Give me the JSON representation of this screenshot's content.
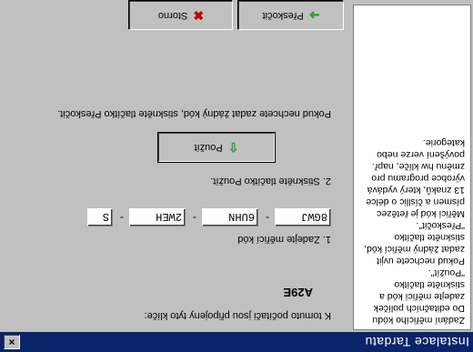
{
  "window": {
    "title": "Instalace Tardatu",
    "close_label": "×"
  },
  "sidebar": {
    "text": "Zadání měřicího kódu\nDo editačních políček\nzadejte měřicí kód a\nstiskněte tlačítko\n\"Použít\".\nPokud nechcete uvjit\nzadat žádný měřicí kód,\nstiskněte tlačítko\n\"Přeskočit\".\nMěřicí kód je řetězec\npísmen a čísllic o délce\n13 znaků, který vydává\nvýrobce programu pro\nzměnu hw klíče, např.\npovýšení verze nebo\nkategorie."
  },
  "main": {
    "pc_label": "K tomuto počítači jsou připojeny tyto klíče:",
    "key_id": "A29E",
    "step1_label": "1. Zadejte měřicí kód",
    "code_fields": [
      "8GWJ",
      "6UHN",
      "2WEH",
      "S"
    ],
    "separator": "-",
    "step2_label": "2. Stiskněte tlačítko Použít.",
    "apply_label": "Použít",
    "skip_hint": "Pokud nechcete zadat žádný kód, stiskněte tlačítko Přeskočit.",
    "skip_label": "Přeskočit",
    "cancel_label": "Storno"
  },
  "icons": {
    "apply": "arrow-up-icon",
    "skip": "arrow-right-icon",
    "cancel": "x-icon"
  },
  "colors": {
    "titlebar": "#0a246a",
    "cancel_icon": "#c00000",
    "arrow_icon": "#2f9e2f"
  }
}
